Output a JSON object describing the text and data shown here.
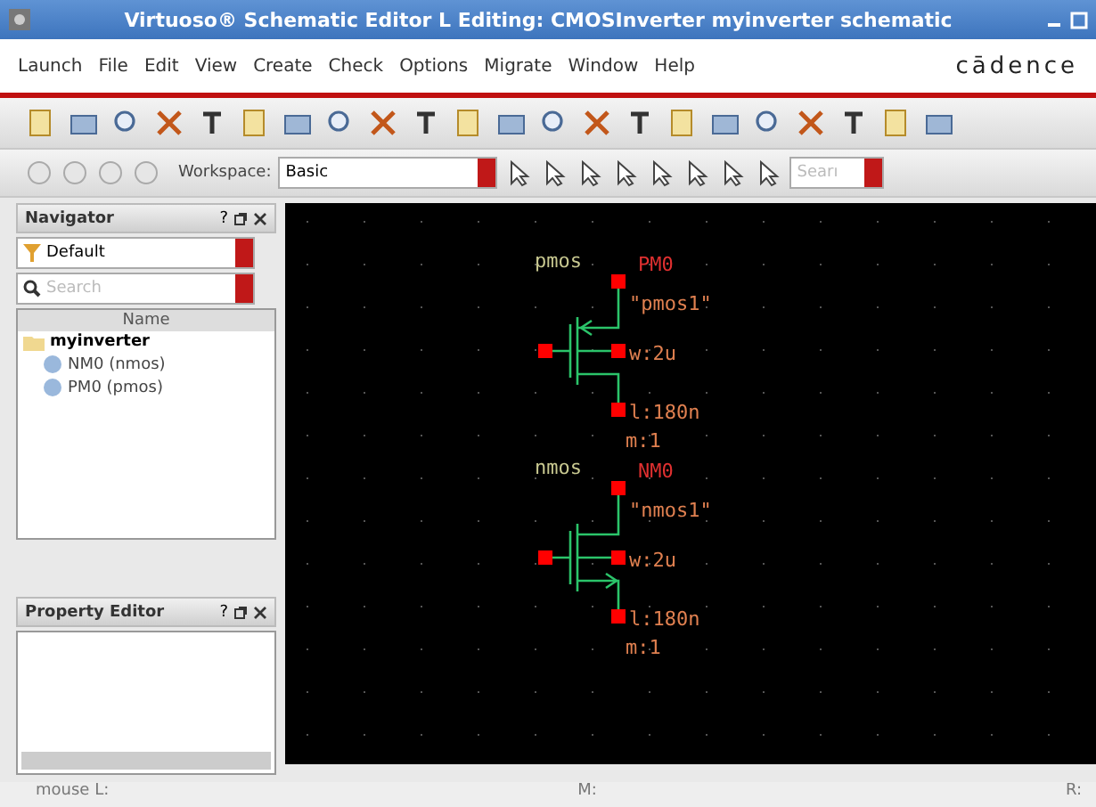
{
  "window": {
    "title": "Virtuoso® Schematic Editor L Editing: CMOSInverter myinverter schematic"
  },
  "menu": [
    "Launch",
    "File",
    "Edit",
    "View",
    "Create",
    "Check",
    "Options",
    "Migrate",
    "Window",
    "Help"
  ],
  "logo": "cādence",
  "toolbar": {
    "workspace_label": "Workspace:",
    "workspace": "Basic",
    "search_placeholder": "Searı"
  },
  "navigator": {
    "title": "Navigator",
    "filter": "Default",
    "search_placeholder": "Search",
    "column": "Name",
    "tree": [
      {
        "label": "myinverter",
        "expanded": true,
        "children": [
          {
            "label": "NM0 (nmos)"
          },
          {
            "label": "PM0 (pmos)"
          }
        ]
      }
    ]
  },
  "property_editor": {
    "title": "Property Editor"
  },
  "panel_controls": "?",
  "schematic": {
    "instances": [
      {
        "kind": "pmos",
        "cell": "pmos",
        "name": "PM0",
        "model": "\"pmos1\"",
        "w": "w:2u",
        "l": "l:180n",
        "m": "m:1"
      },
      {
        "kind": "nmos",
        "cell": "nmos",
        "name": "NM0",
        "model": "\"nmos1\"",
        "w": "w:2u",
        "l": "l:180n",
        "m": "m:1"
      }
    ]
  },
  "status_bar": [
    "mouse L:",
    "M:",
    "R:"
  ]
}
